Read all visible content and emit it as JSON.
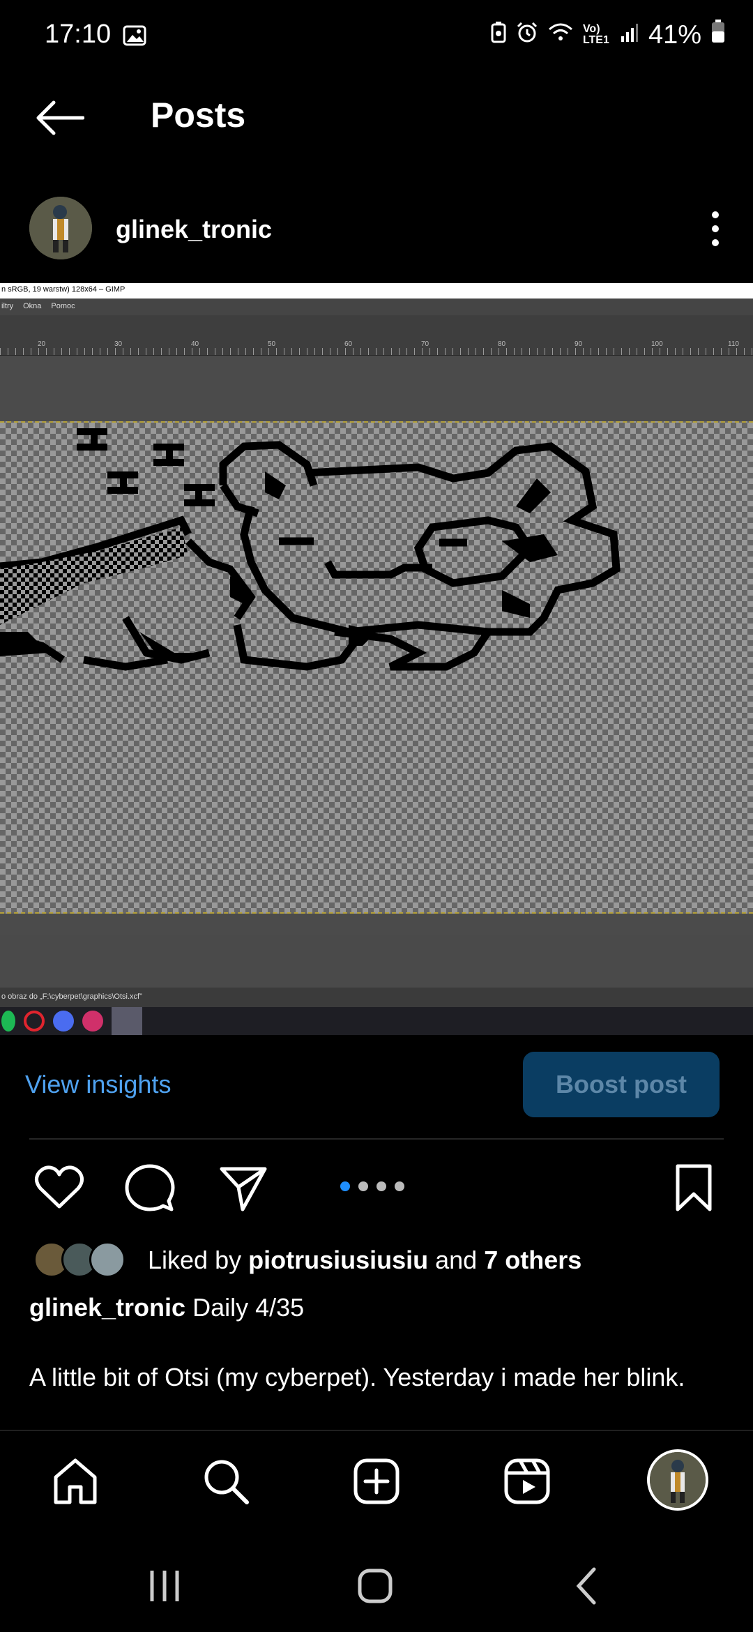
{
  "status_bar": {
    "time": "17:10",
    "network_label": "Vo) LTE1",
    "battery": "41%",
    "icons": [
      "image-icon",
      "battery-saver-icon",
      "alarm-icon",
      "wifi-icon",
      "signal-icon",
      "battery-icon"
    ]
  },
  "header": {
    "title": "Posts"
  },
  "post": {
    "username": "glinek_tronic",
    "image": {
      "gimp_title": "n sRGB, 19 warstw) 128x64 – GIMP",
      "gimp_menu": [
        "iltry",
        "Okna",
        "Pomoc"
      ],
      "ruler_ticks": [
        "20",
        "30",
        "40",
        "50",
        "60",
        "70",
        "80",
        "90",
        "100",
        "110"
      ],
      "gimp_status": "o obraz do „F:\\cyberpet\\graphics\\Otsi.xcf”"
    },
    "carousel": {
      "count": 4,
      "active_index": 0
    },
    "liked_by_prefix": "Liked by",
    "liked_by_user": "piotrusiusiusiu",
    "liked_by_and": "and",
    "liked_by_others": "7 others",
    "caption_user": "glinek_tronic",
    "caption_text": "Daily 4/35",
    "description": "A little bit of Otsi (my cyberpet). Yesterday i made her blink."
  },
  "insights": {
    "view_label": "View insights",
    "boost_label": "Boost post"
  },
  "colors": {
    "accent_blue": "#4fa2f0",
    "boost_bg": "#0a3d62",
    "dot_active": "#1f8fff"
  }
}
